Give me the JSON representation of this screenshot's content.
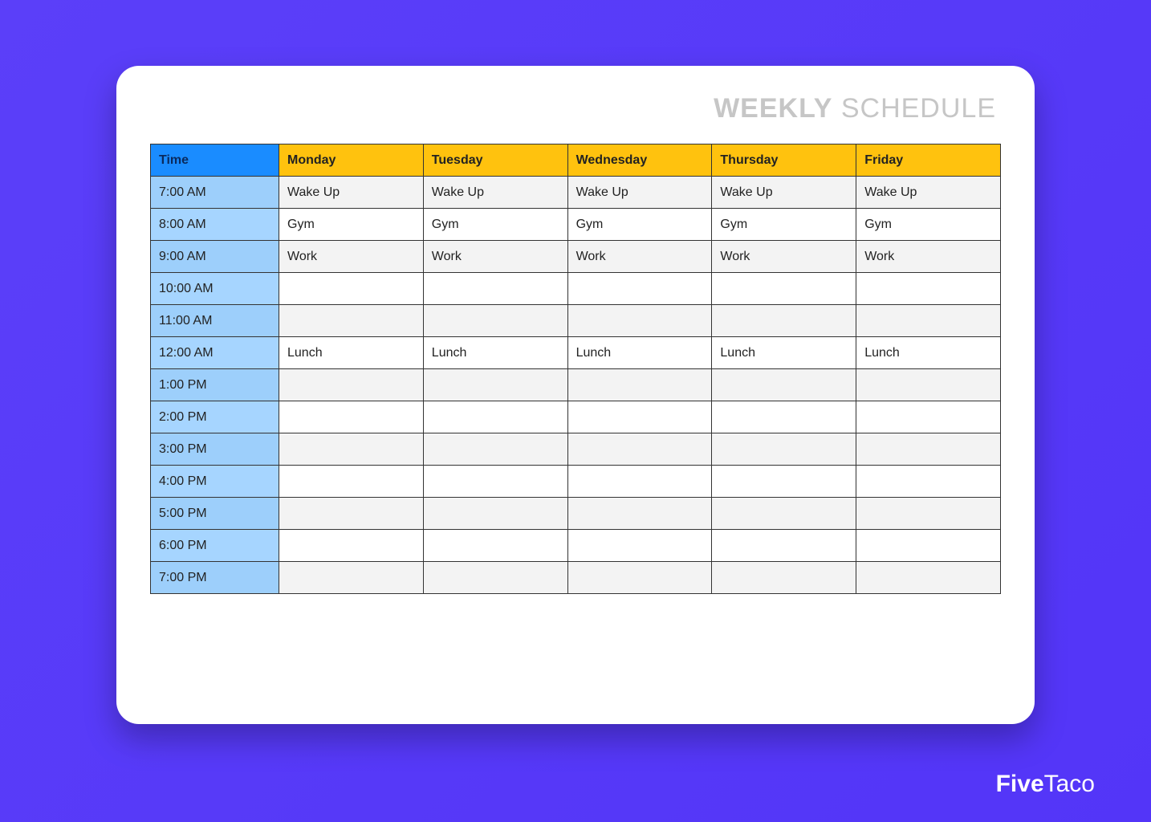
{
  "title_bold": "WEEKLY",
  "title_light": " SCHEDULE",
  "brand_five": "Five",
  "brand_taco": "Taco",
  "headers": {
    "time": "Time",
    "days": [
      "Monday",
      "Tuesday",
      "Wednesday",
      "Thursday",
      "Friday"
    ]
  },
  "rows": [
    {
      "time": "7:00 AM",
      "cells": [
        "Wake Up",
        "Wake Up",
        "Wake Up",
        "Wake Up",
        "Wake Up"
      ]
    },
    {
      "time": "8:00 AM",
      "cells": [
        "Gym",
        "Gym",
        "Gym",
        "Gym",
        "Gym"
      ]
    },
    {
      "time": "9:00 AM",
      "cells": [
        "Work",
        "Work",
        "Work",
        "Work",
        "Work"
      ]
    },
    {
      "time": "10:00 AM",
      "cells": [
        "",
        "",
        "",
        "",
        ""
      ]
    },
    {
      "time": "11:00 AM",
      "cells": [
        "",
        "",
        "",
        "",
        ""
      ]
    },
    {
      "time": "12:00 AM",
      "cells": [
        "Lunch",
        "Lunch",
        "Lunch",
        "Lunch",
        "Lunch"
      ]
    },
    {
      "time": "1:00 PM",
      "cells": [
        "",
        "",
        "",
        "",
        ""
      ]
    },
    {
      "time": "2:00 PM",
      "cells": [
        "",
        "",
        "",
        "",
        ""
      ]
    },
    {
      "time": "3:00 PM",
      "cells": [
        "",
        "",
        "",
        "",
        ""
      ]
    },
    {
      "time": "4:00 PM",
      "cells": [
        "",
        "",
        "",
        "",
        ""
      ]
    },
    {
      "time": "5:00 PM",
      "cells": [
        "",
        "",
        "",
        "",
        ""
      ]
    },
    {
      "time": "6:00 PM",
      "cells": [
        "",
        "",
        "",
        "",
        ""
      ]
    },
    {
      "time": "7:00 PM",
      "cells": [
        "",
        "",
        "",
        "",
        ""
      ]
    }
  ]
}
